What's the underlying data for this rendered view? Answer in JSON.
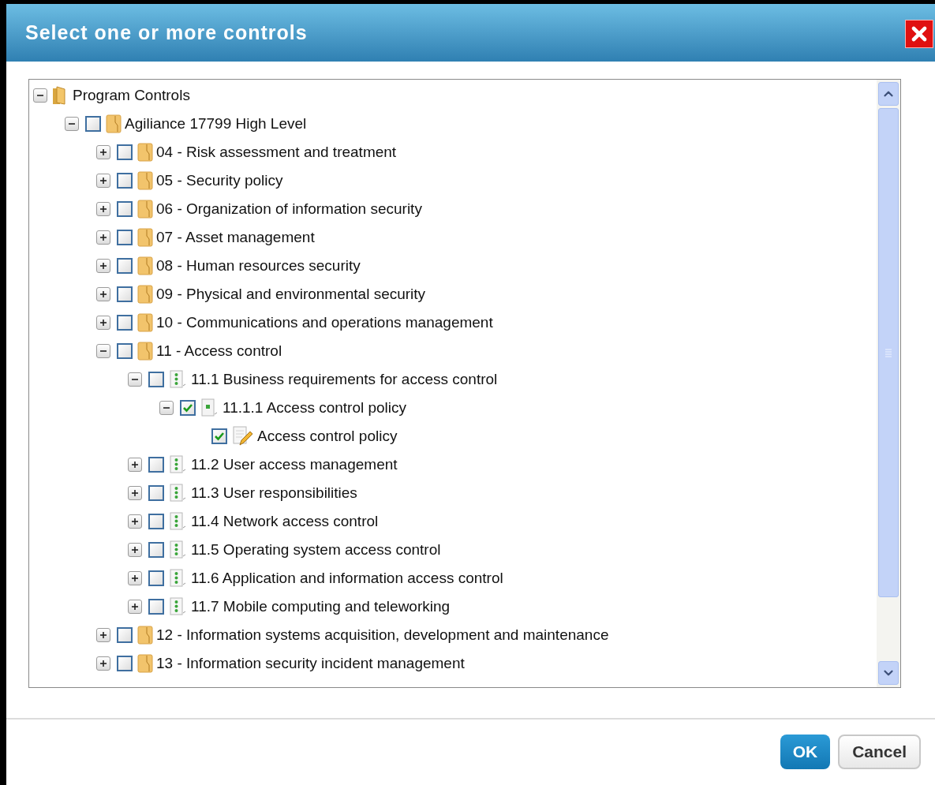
{
  "dialog": {
    "title": "Select one or more controls"
  },
  "tree": {
    "label": "Program Controls",
    "kind": "root",
    "expanded": true,
    "children": [
      {
        "label": "Agiliance 17799 High Level",
        "kind": "folder",
        "expanded": true,
        "checked": false,
        "children": [
          {
            "label": "04 - Risk assessment and treatment",
            "kind": "folder",
            "expanded": false,
            "checked": false
          },
          {
            "label": "05 - Security policy",
            "kind": "folder",
            "expanded": false,
            "checked": false
          },
          {
            "label": "06 - Organization of information security",
            "kind": "folder",
            "expanded": false,
            "checked": false
          },
          {
            "label": "07 - Asset management",
            "kind": "folder",
            "expanded": false,
            "checked": false
          },
          {
            "label": "08 - Human resources security",
            "kind": "folder",
            "expanded": false,
            "checked": false
          },
          {
            "label": "09 - Physical and environmental security",
            "kind": "folder",
            "expanded": false,
            "checked": false
          },
          {
            "label": "10 - Communications and operations management",
            "kind": "folder",
            "expanded": false,
            "checked": false
          },
          {
            "label": "11 - Access control",
            "kind": "folder",
            "expanded": true,
            "checked": false,
            "children": [
              {
                "label": "11.1 Business requirements for access control",
                "kind": "section",
                "expanded": true,
                "checked": false,
                "children": [
                  {
                    "label": "11.1.1 Access control policy",
                    "kind": "control",
                    "expanded": true,
                    "checked": true,
                    "children": [
                      {
                        "label": "Access control policy",
                        "kind": "policy",
                        "checked": true
                      }
                    ]
                  }
                ]
              },
              {
                "label": "11.2 User access management",
                "kind": "section",
                "expanded": false,
                "checked": false
              },
              {
                "label": "11.3 User responsibilities",
                "kind": "section",
                "expanded": false,
                "checked": false
              },
              {
                "label": "11.4 Network access control",
                "kind": "section",
                "expanded": false,
                "checked": false
              },
              {
                "label": "11.5 Operating system access control",
                "kind": "section",
                "expanded": false,
                "checked": false
              },
              {
                "label": "11.6 Application and information access control",
                "kind": "section",
                "expanded": false,
                "checked": false
              },
              {
                "label": "11.7 Mobile computing and teleworking",
                "kind": "section",
                "expanded": false,
                "checked": false
              }
            ]
          },
          {
            "label": "12 - Information systems acquisition, development and maintenance",
            "kind": "folder",
            "expanded": false,
            "checked": false
          },
          {
            "label": "13 - Information security incident management",
            "kind": "folder",
            "expanded": false,
            "checked": false
          }
        ]
      }
    ]
  },
  "buttons": [
    {
      "label": "OK",
      "kind": "primary"
    },
    {
      "label": "Cancel",
      "kind": "secondary"
    }
  ]
}
